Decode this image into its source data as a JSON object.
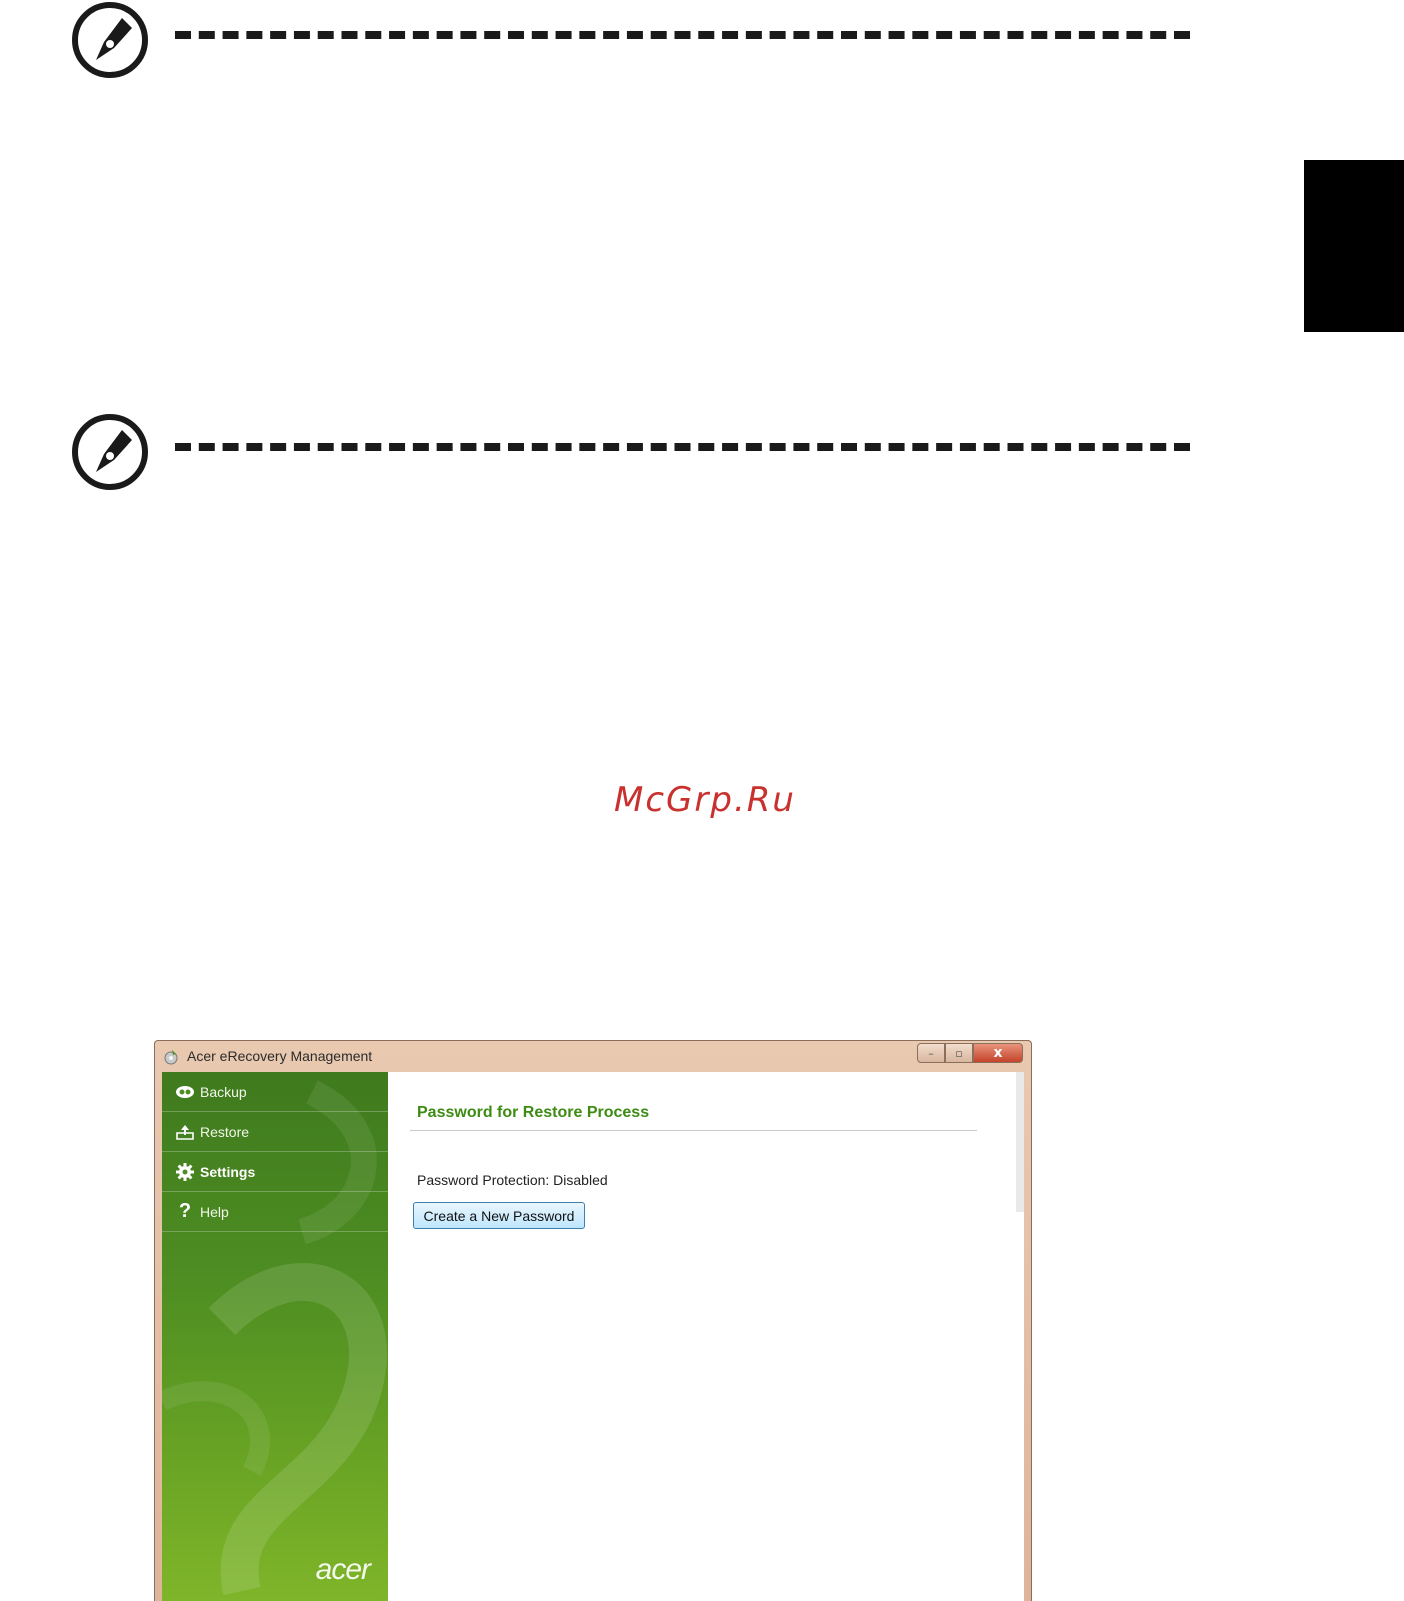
{
  "window": {
    "title": "Acer eRecovery Management",
    "controls": {
      "minimize": "–",
      "maximize": "▫",
      "close": "x"
    }
  },
  "sidebar": {
    "items": [
      {
        "label": "Backup",
        "icon": "backup-icon",
        "active": false
      },
      {
        "label": "Restore",
        "icon": "restore-icon",
        "active": false
      },
      {
        "label": "Settings",
        "icon": "gear-icon",
        "active": true
      },
      {
        "label": "Help",
        "icon": "help-icon",
        "active": false
      }
    ],
    "brand": "acer"
  },
  "content": {
    "section_title": "Password for Restore Process",
    "status": "Password Protection: Disabled",
    "button_label": "Create a New Password"
  },
  "watermark": "McGrp.Ru",
  "colors": {
    "accent_green": "#3d8c14",
    "sidebar_green": "#4e8e22",
    "watermark_red": "#c8312e",
    "window_frame": "#deb49a"
  }
}
